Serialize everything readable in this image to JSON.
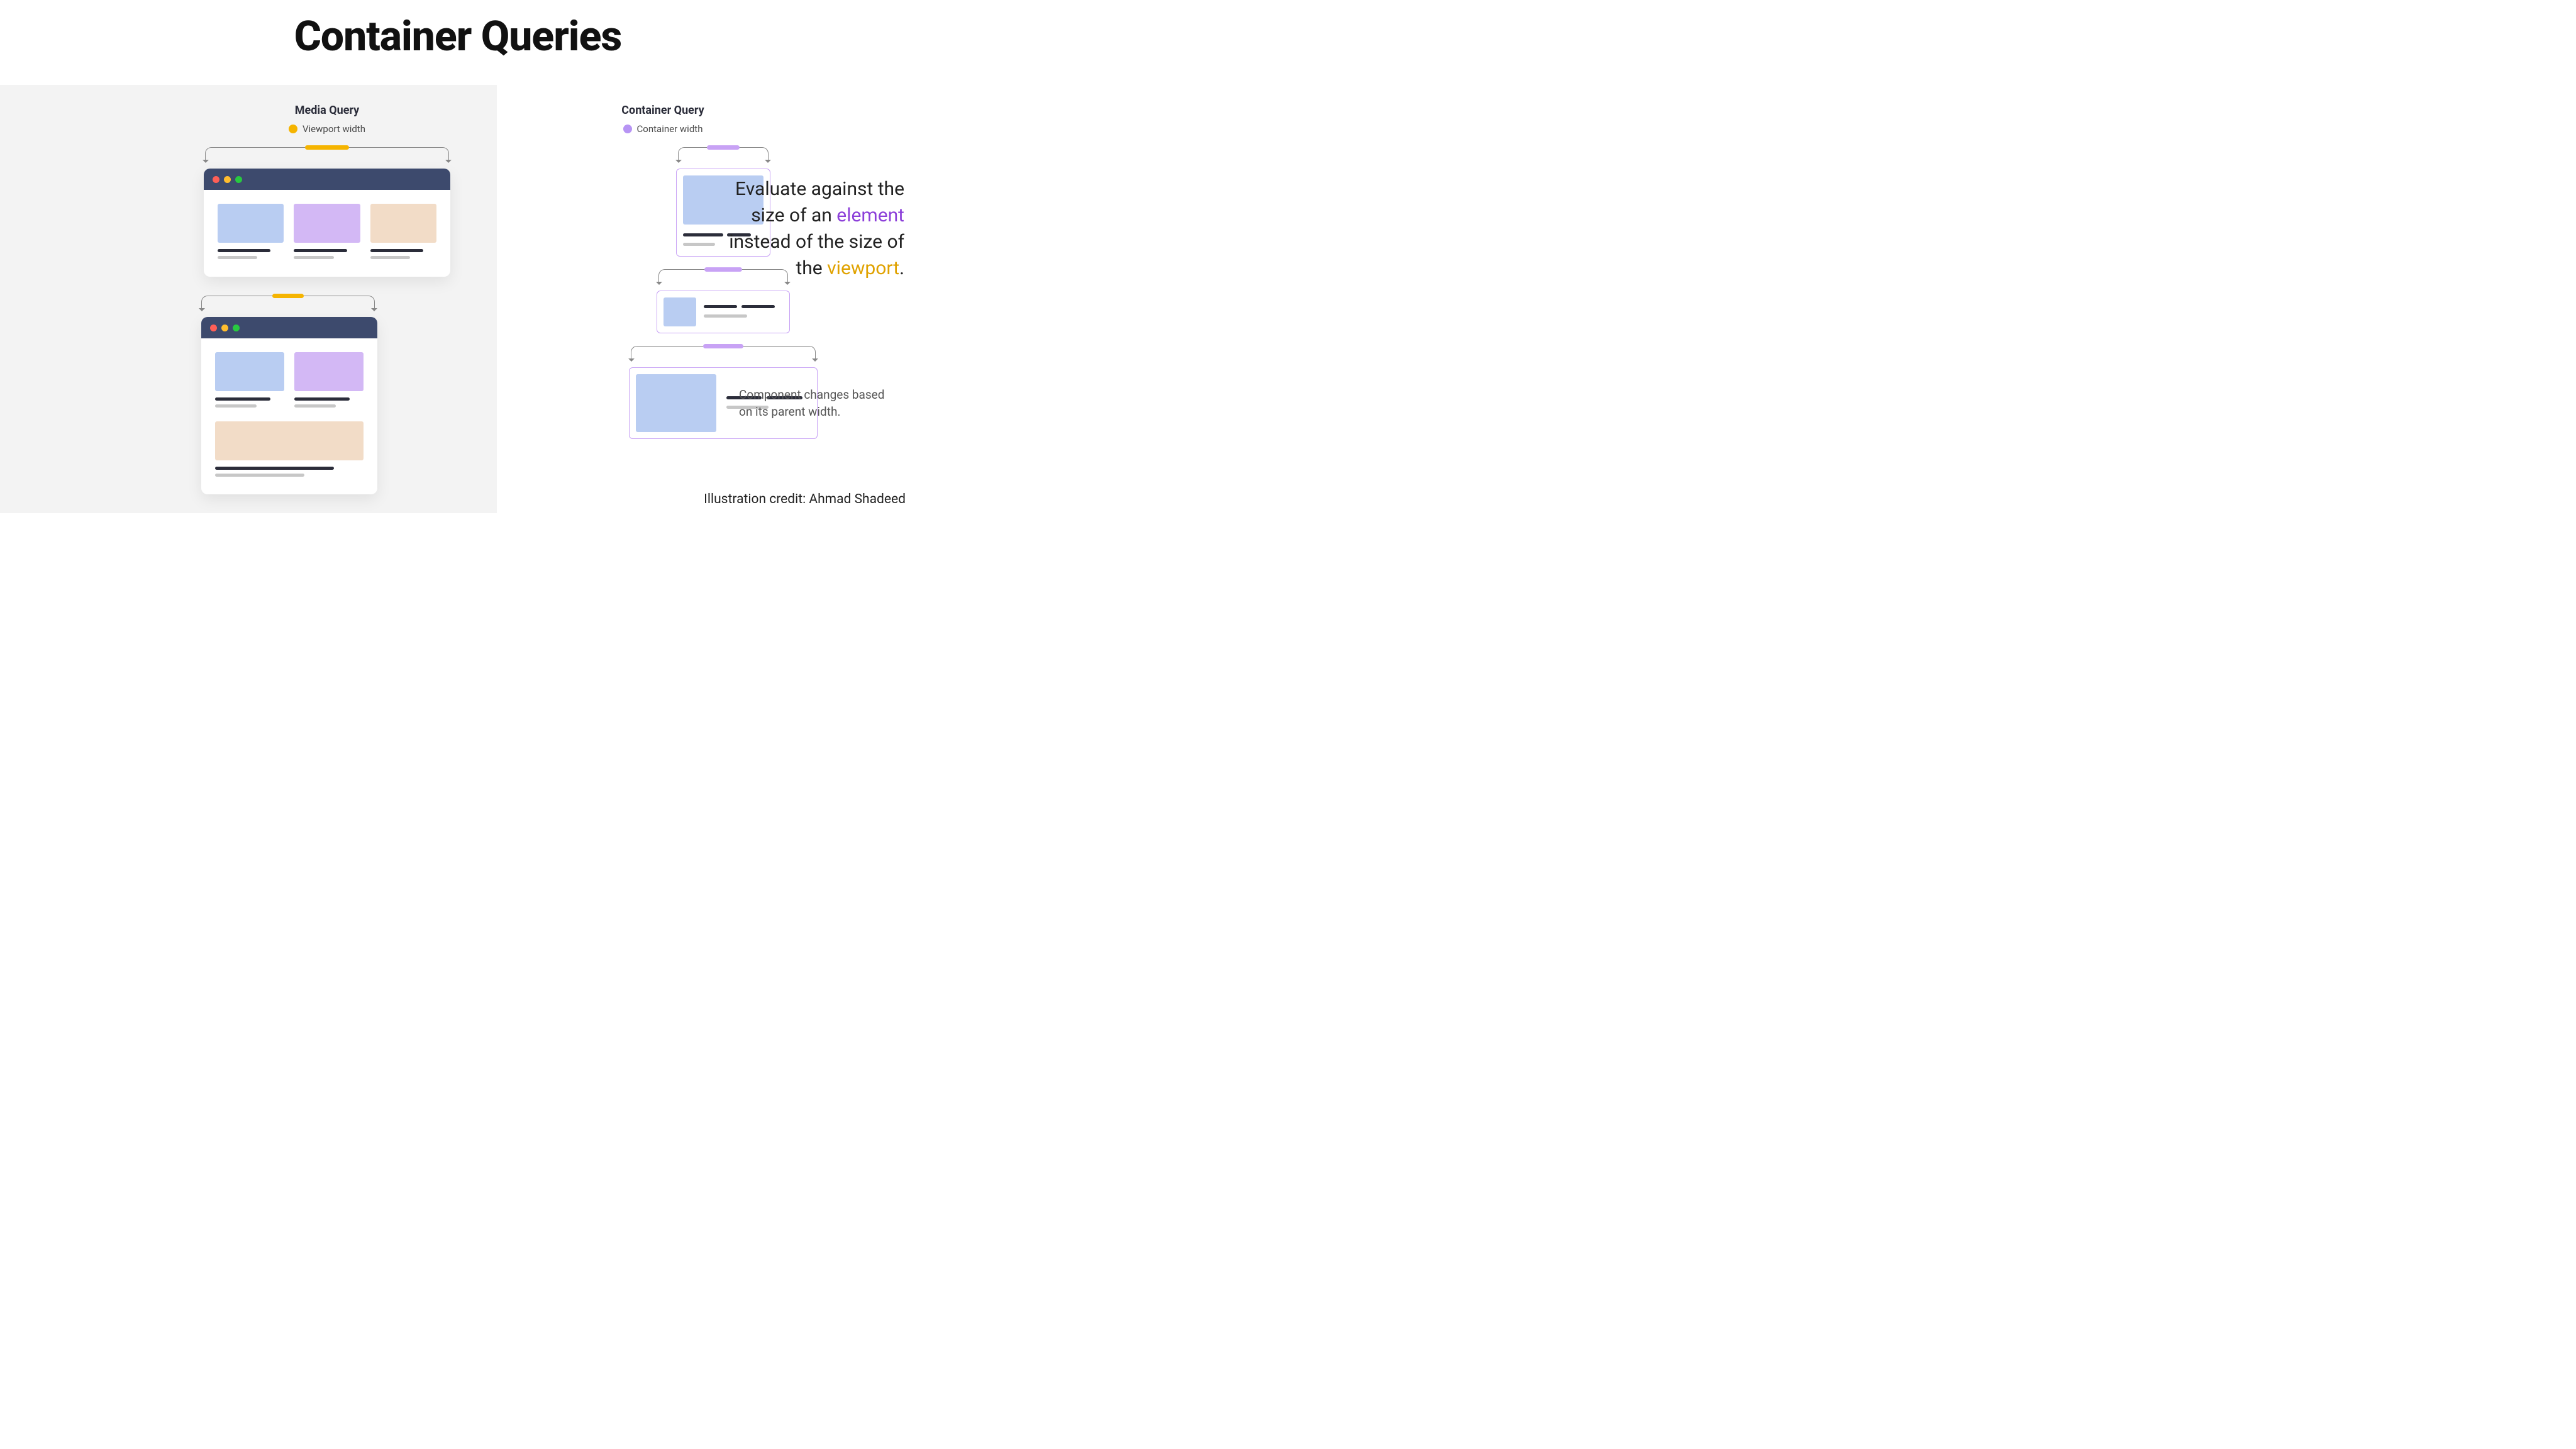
{
  "title": "Container Queries",
  "media_query": {
    "heading": "Media Query",
    "legend": "Viewport width"
  },
  "container_query": {
    "heading": "Container Query",
    "legend": "Container width"
  },
  "description": {
    "part1": "Evaluate against the size of an ",
    "highlight_element": "element",
    "part2": " instead of the size of the ",
    "highlight_viewport": "viewport",
    "part3": "."
  },
  "sub_description": "Component changes based on its parent width.",
  "credit": "Illustration credit: Ahmad Shadeed"
}
